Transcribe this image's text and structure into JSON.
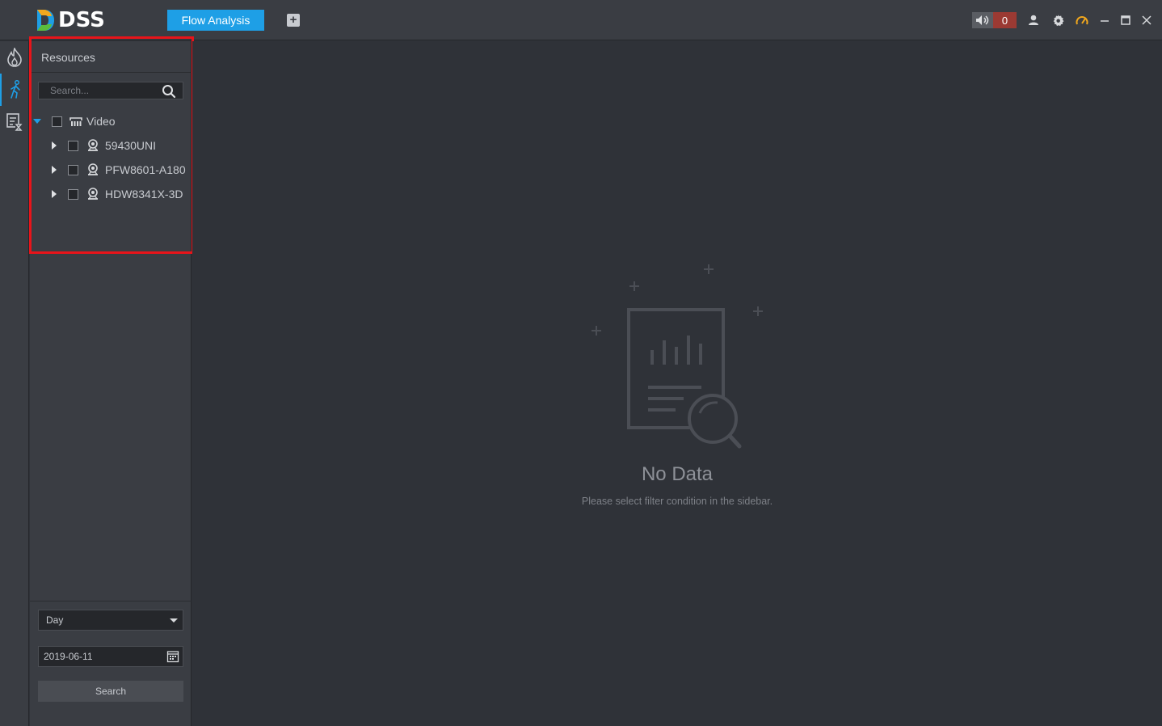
{
  "app": {
    "brand": "DSS"
  },
  "toolbar": {
    "active_tab": "Flow Analysis",
    "add_tab_label": "+",
    "alarm_count": "0"
  },
  "rail": {
    "items": [
      {
        "icon": "flame-icon"
      },
      {
        "icon": "person-walk-icon",
        "active": true
      },
      {
        "icon": "report-clock-icon"
      }
    ]
  },
  "sidebar": {
    "title": "Resources",
    "search_placeholder": "Search...",
    "tree": {
      "root": "Video",
      "children": [
        "59430UNI",
        "PFW8601-A180",
        "HDW8341X-3D"
      ]
    },
    "period": "Day",
    "date": "2019-06-11",
    "search_button": "Search"
  },
  "main": {
    "empty_title": "No Data",
    "empty_subtitle": "Please select filter condition in the sidebar."
  },
  "colors": {
    "accent": "#1e9fe6",
    "alarm": "#9b3a33",
    "highlight": "#e8141a",
    "background": "#2f3238",
    "panel": "#3a3d43"
  }
}
